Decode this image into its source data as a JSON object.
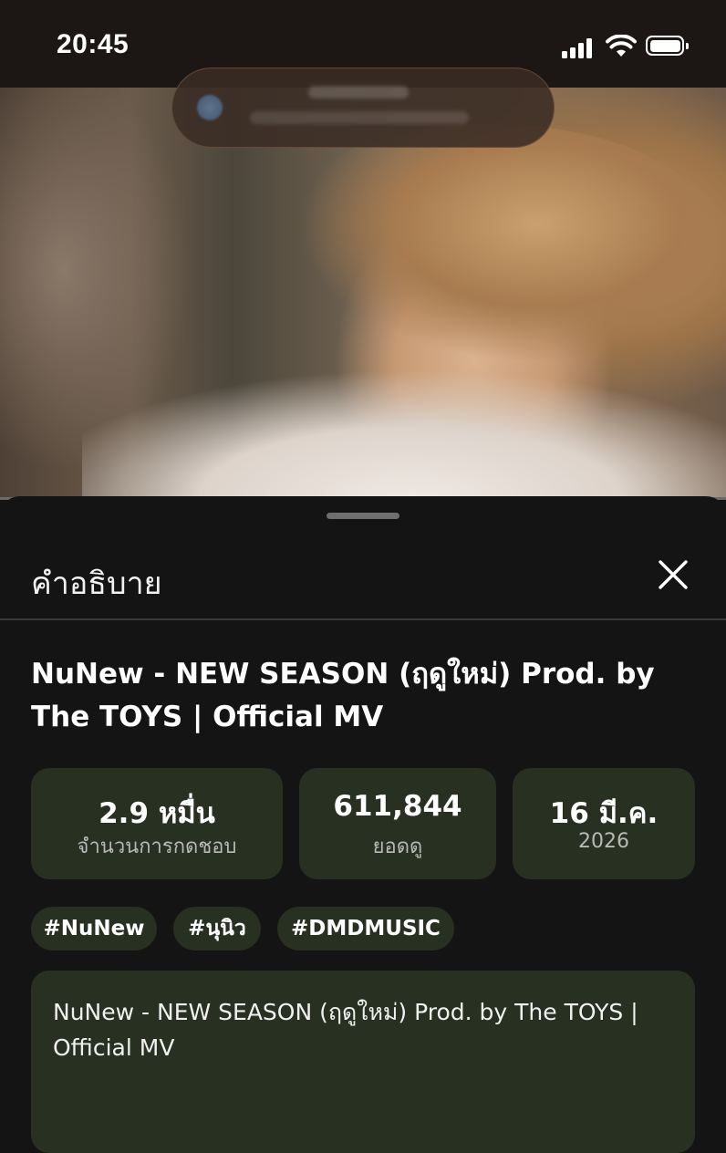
{
  "status_bar": {
    "time": "20:45"
  },
  "sheet": {
    "title": "คำอธิบาย",
    "video_title": "NuNew - NEW SEASON (ฤดูใหม่) Prod. by The TOYS | Official MV",
    "stats": [
      {
        "value": "2.9 หมื่น",
        "label": "จำนวนการกดชอบ"
      },
      {
        "value": "611,844",
        "label": "ยอดดู"
      },
      {
        "value": "16 มี.ค.",
        "label": "2026"
      }
    ],
    "tags": [
      "#NuNew",
      "#นุนิว",
      "#DMDMUSIC"
    ],
    "description": "NuNew - NEW SEASON (ฤดูใหม่) Prod. by The TOYS | Official MV"
  },
  "icons": {
    "close": "close-icon",
    "signal": "cellular-signal-icon",
    "wifi": "wifi-icon",
    "battery": "battery-icon"
  },
  "colors": {
    "sheet_bg": "#141414",
    "card_bg": "#283021",
    "muted_text": "#b8b8b8"
  }
}
